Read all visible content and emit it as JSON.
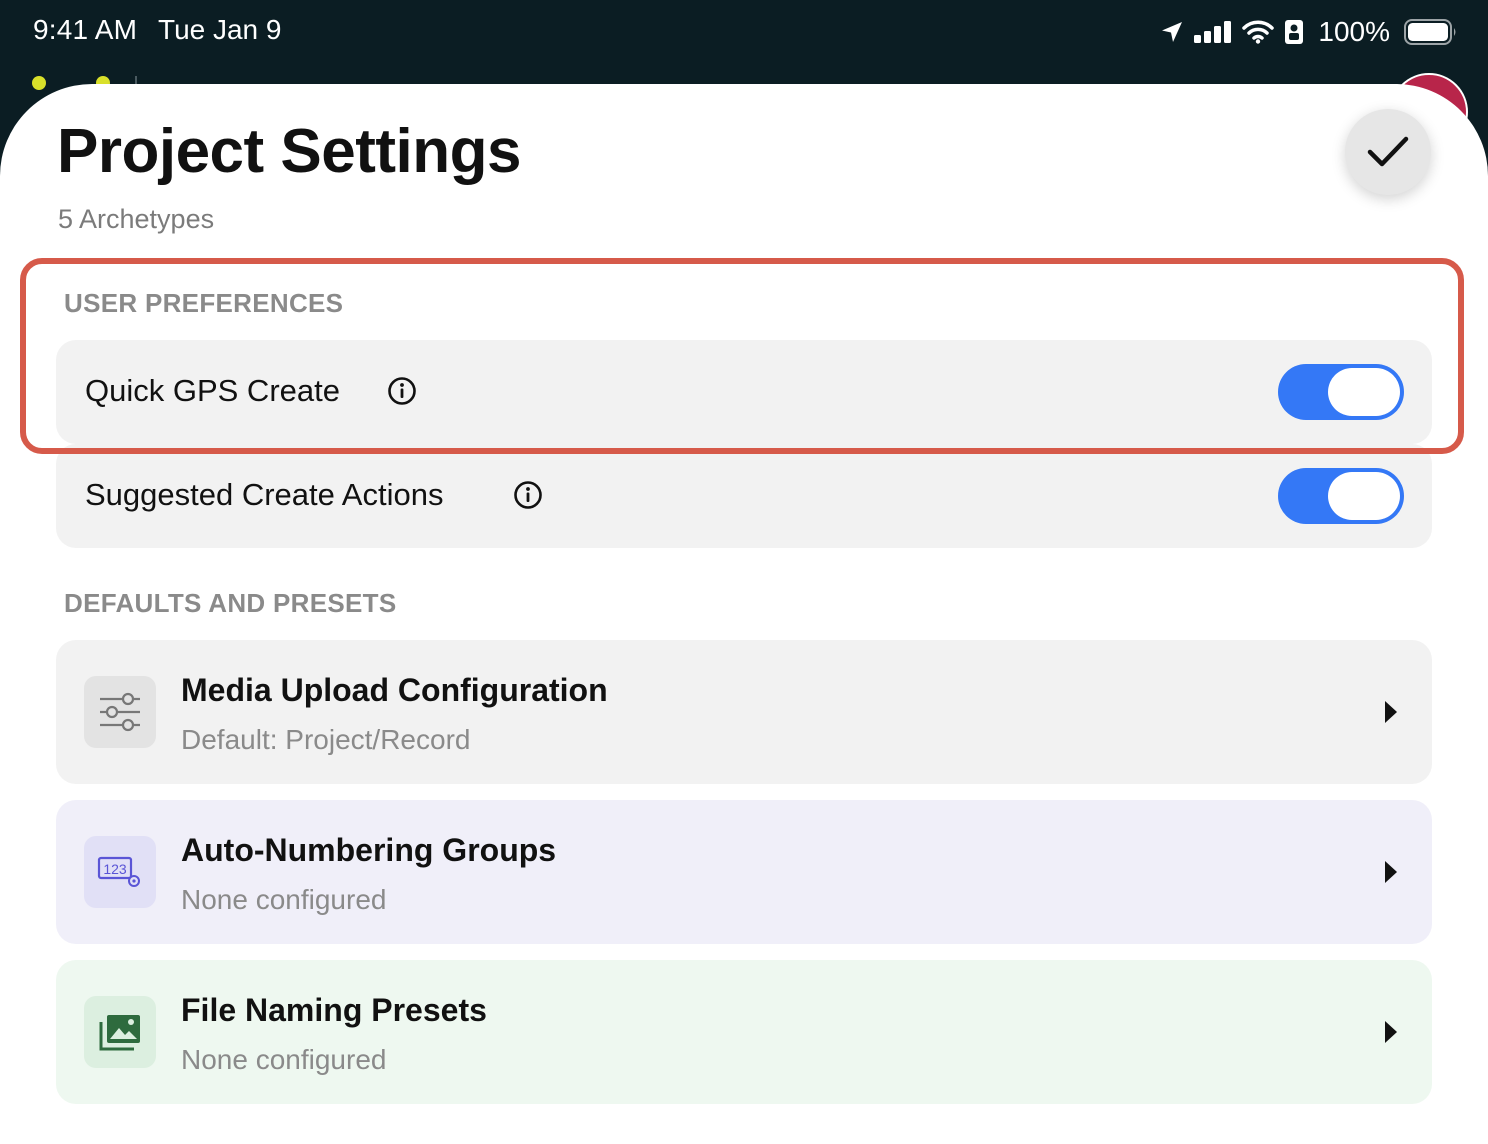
{
  "status_bar": {
    "time": "9:41 AM",
    "date": "Tue Jan 9",
    "battery": "100%"
  },
  "header": {
    "title": "Project Settings",
    "subtitle": "5 Archetypes",
    "done_icon": "checkmark-icon"
  },
  "user_preferences": {
    "header": "USER PREFERENCES",
    "items": [
      {
        "label": "Quick GPS Create",
        "enabled": true,
        "icon": "info-icon"
      },
      {
        "label": "Suggested Create Actions",
        "enabled": true,
        "icon": "info-icon"
      }
    ]
  },
  "defaults": {
    "header": "DEFAULTS AND PRESETS",
    "items": [
      {
        "title": "Media Upload Configuration",
        "subtitle": "Default: Project/Record",
        "icon": "sliders-icon",
        "bg": "#f2f2f2",
        "icon_bg": "#e3e3e3"
      },
      {
        "title": "Auto-Numbering Groups",
        "subtitle": "None configured",
        "icon": "numbering-icon",
        "bg": "#f0eff9",
        "icon_bg": "#e1e0f6"
      },
      {
        "title": "File Naming Presets",
        "subtitle": "None configured",
        "icon": "images-icon",
        "bg": "#eef8f0",
        "icon_bg": "#dcefe0"
      }
    ]
  },
  "colors": {
    "toggle_on": "#3478f6",
    "highlight": "#d65a4a"
  }
}
